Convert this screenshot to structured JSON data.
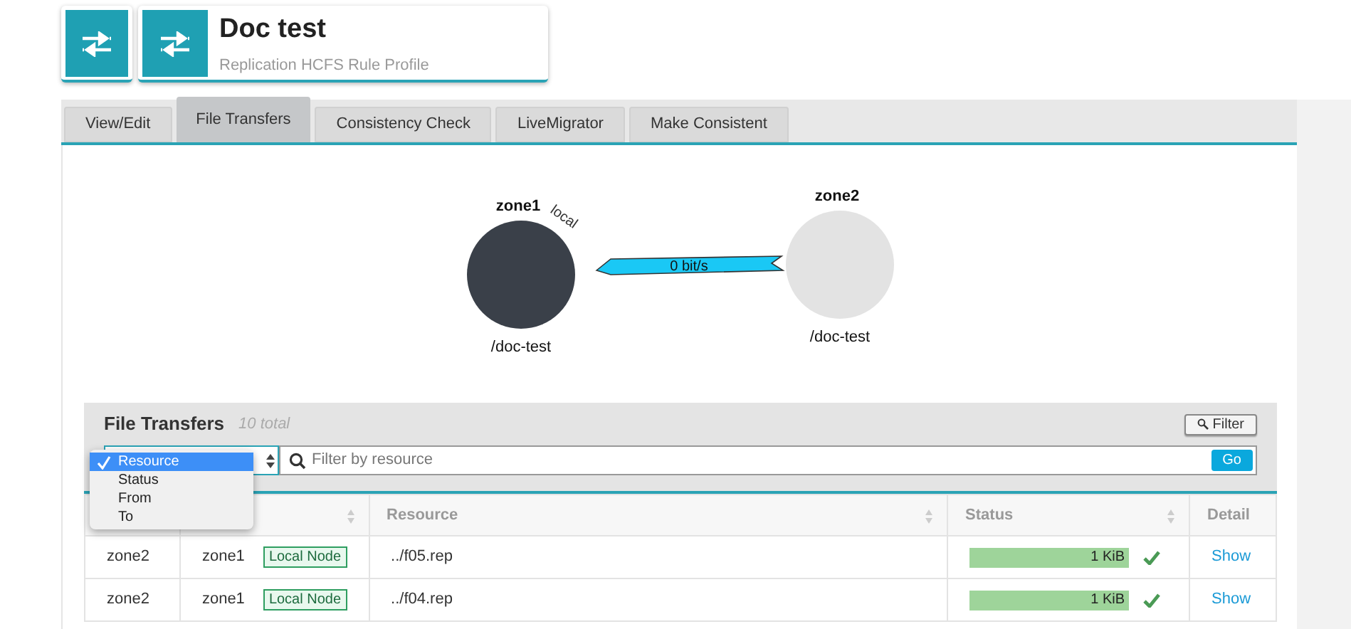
{
  "header": {
    "title": "Doc test",
    "subtitle": "Replication HCFS Rule Profile"
  },
  "tabs": [
    {
      "label": "View/Edit",
      "selected": false
    },
    {
      "label": "File Transfers",
      "selected": true
    },
    {
      "label": "Consistency Check",
      "selected": false
    },
    {
      "label": "LiveMigrator",
      "selected": false
    },
    {
      "label": "Make Consistent",
      "selected": false
    }
  ],
  "diagram": {
    "nodes": [
      {
        "name": "zone1",
        "local": true,
        "tag": "local",
        "path": "/doc-test"
      },
      {
        "name": "zone2",
        "local": false,
        "path": "/doc-test"
      }
    ],
    "link": {
      "rate": "0 bit/s"
    }
  },
  "file_transfers": {
    "title": "File Transfers",
    "count": "10 total",
    "filter_button": "Filter",
    "filter_by": {
      "options": [
        {
          "label": "Resource",
          "selected": true
        },
        {
          "label": "Status",
          "selected": false
        },
        {
          "label": "From",
          "selected": false
        },
        {
          "label": "To",
          "selected": false
        }
      ]
    },
    "search": {
      "placeholder": "Filter by resource"
    },
    "go_button": "Go",
    "columns": [
      {
        "sortable": false
      },
      {
        "sortable": true
      },
      {
        "label": "Resource",
        "sortable": true
      },
      {
        "label": "Status",
        "sortable": true
      },
      {
        "label": "Detail",
        "sortable": false
      }
    ],
    "rows": [
      {
        "from": "zone2",
        "to": "zone1",
        "badge": "Local Node",
        "resource": "../f05.rep",
        "level": 1,
        "size": "1 KiB",
        "complete": true,
        "detail": "Show"
      },
      {
        "from": "zone2",
        "to": "zone1",
        "badge": "Local Node",
        "resource": "../f04.rep",
        "level": 1,
        "size": "1 KiB",
        "complete": true,
        "detail": "Show"
      }
    ]
  }
}
